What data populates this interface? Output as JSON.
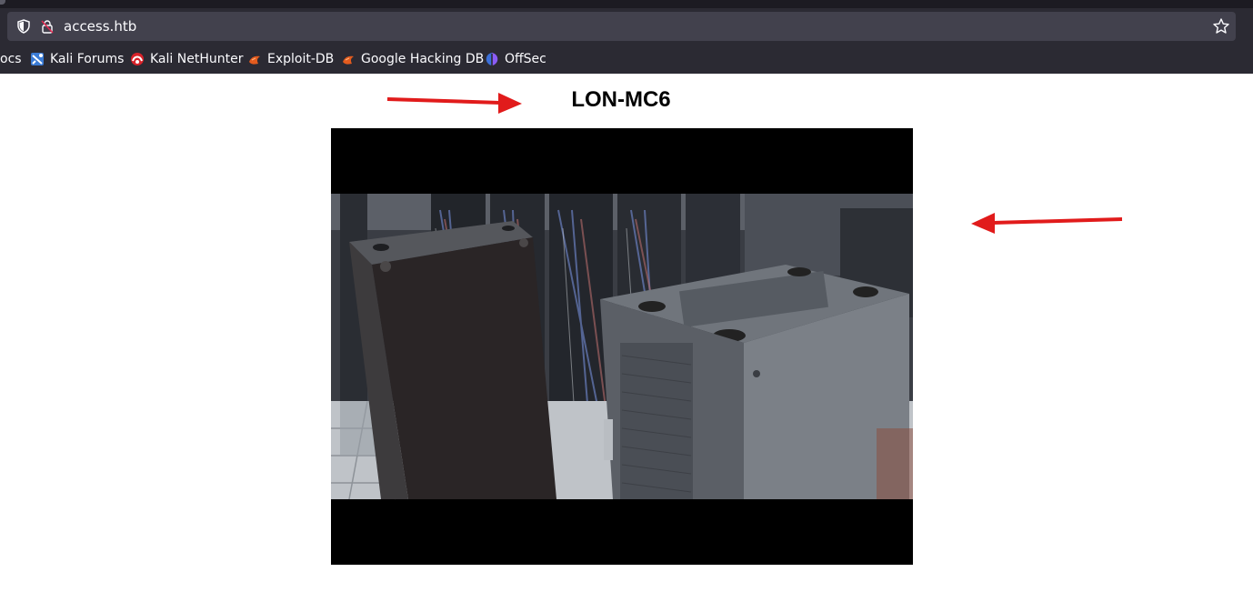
{
  "browser": {
    "url": "access.htb",
    "bookmarks": [
      {
        "label": "ocs",
        "icon": "docs-icon"
      },
      {
        "label": "Kali Forums",
        "icon": "kali-forums-icon"
      },
      {
        "label": "Kali NetHunter",
        "icon": "kali-nethunter-icon"
      },
      {
        "label": "Exploit-DB",
        "icon": "exploit-db-icon"
      },
      {
        "label": "Google Hacking DB",
        "icon": "google-hacking-db-icon"
      },
      {
        "label": "OffSec",
        "icon": "offsec-icon"
      }
    ]
  },
  "page": {
    "camera_title": "LON-MC6",
    "feed_image": "server-room-camera-feed",
    "annotation_color": "#e11b1b"
  },
  "colors": {
    "chrome_dark": "#1c1b22",
    "toolbar": "#2b2a33",
    "urlbar": "#42414d",
    "text_light": "#fbfbfe"
  }
}
